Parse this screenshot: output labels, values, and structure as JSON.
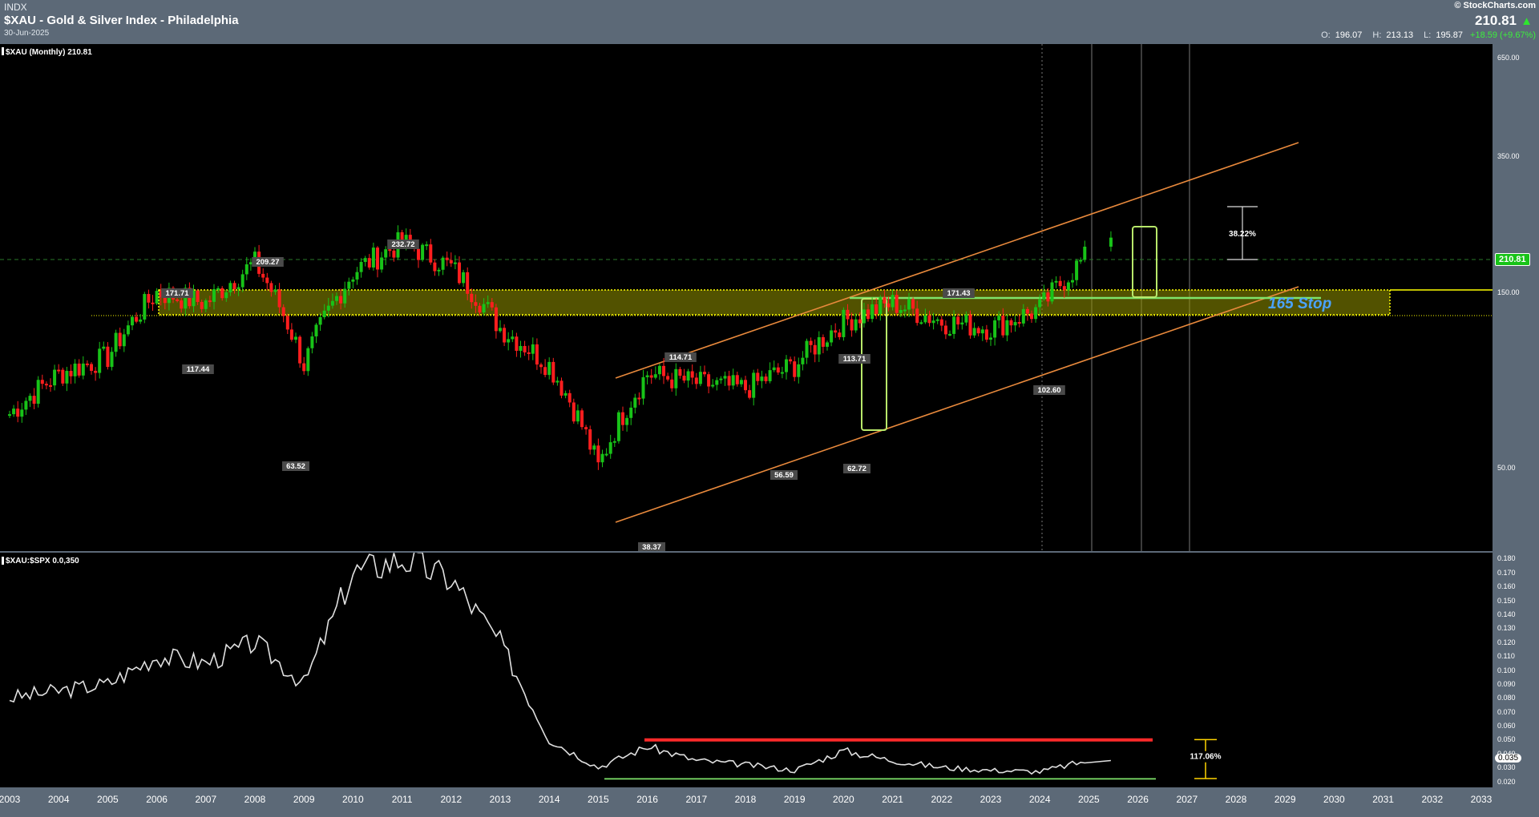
{
  "header": {
    "exchange": "INDX",
    "title": "$XAU - Gold & Silver Index - Philadelphia",
    "date": "30-Jun-2025",
    "brand": "© StockCharts.com",
    "price": "210.81",
    "open_label": "O:",
    "open": "196.07",
    "high_label": "H:",
    "high": "213.13",
    "low_label": "L:",
    "low": "195.87",
    "change": "+18.59 (+9.67%)"
  },
  "colors": {
    "up": "#18c318",
    "down": "#ff1e1e",
    "channel": "#e8893c",
    "zone": "#ffff00",
    "support": "#7ee36a",
    "ratio": "#e0e0e0",
    "annot": "#4aa3ff"
  },
  "main": {
    "legend": "$XAU (Monthly) 210.81",
    "last_price_tag": "210.81",
    "stop_label": "165 Stop",
    "measure_label": "38.22%",
    "labels": [
      "232.72",
      "209.27",
      "171.71",
      "117.44",
      "63.52",
      "114.71",
      "56.59",
      "113.71",
      "62.72",
      "171.43",
      "102.60",
      "38.37"
    ]
  },
  "ratio": {
    "legend": "$XAU:$SPX 0.0,350",
    "last_tag": "0.035",
    "measure_label": "117.06%"
  },
  "chart_data": [
    {
      "type": "line",
      "title": "$XAU (Monthly) 210.81",
      "x": [
        "2003",
        "2004",
        "2005",
        "2006",
        "2007",
        "2008",
        "2009",
        "2010",
        "2011",
        "2012",
        "2013",
        "2014",
        "2015",
        "2016",
        "2017",
        "2018",
        "2019",
        "2020",
        "2021",
        "2022",
        "2023",
        "2024",
        "2025"
      ],
      "values": [
        70,
        90,
        100,
        150,
        140,
        180,
        95,
        170,
        205,
        175,
        120,
        95,
        50,
        90,
        85,
        82,
        95,
        125,
        140,
        125,
        120,
        135,
        190
      ],
      "y_ticks": [
        "650.00",
        "350.00",
        "150.00",
        "50.00"
      ],
      "ylim": [
        30,
        700
      ],
      "scale": "log",
      "annotations": [
        "232.72",
        "209.27",
        "171.71",
        "117.44",
        "63.52",
        "114.71",
        "56.59",
        "113.71",
        "62.72",
        "171.43",
        "102.60",
        "38.37",
        "165 Stop",
        "38.22%"
      ]
    },
    {
      "type": "line",
      "title": "$XAU:$SPX 0.0,350",
      "x": [
        "2003",
        "2004",
        "2005",
        "2006",
        "2007",
        "2008",
        "2009",
        "2010",
        "2011",
        "2012",
        "2013",
        "2014",
        "2015",
        "2016",
        "2017",
        "2018",
        "2019",
        "2020",
        "2021",
        "2022",
        "2023",
        "2024",
        "2025"
      ],
      "values": [
        0.08,
        0.085,
        0.09,
        0.11,
        0.105,
        0.12,
        0.09,
        0.17,
        0.18,
        0.165,
        0.12,
        0.05,
        0.03,
        0.045,
        0.035,
        0.032,
        0.028,
        0.042,
        0.035,
        0.03,
        0.028,
        0.027,
        0.035
      ],
      "y_ticks": [
        "0.180",
        "0.170",
        "0.160",
        "0.150",
        "0.140",
        "0.130",
        "0.120",
        "0.110",
        "0.100",
        "0.090",
        "0.080",
        "0.070",
        "0.060",
        "0.050",
        "0.040",
        "0.030",
        "0.020"
      ],
      "ylim": [
        0.018,
        0.182
      ],
      "annotations": [
        "117.06%",
        "0.035"
      ]
    }
  ],
  "x_axis": [
    "2003",
    "2004",
    "2005",
    "2006",
    "2007",
    "2008",
    "2009",
    "2010",
    "2011",
    "2012",
    "2013",
    "2014",
    "2015",
    "2016",
    "2017",
    "2018",
    "2019",
    "2020",
    "2021",
    "2022",
    "2023",
    "2024",
    "2025",
    "2026",
    "2027",
    "2028",
    "2029",
    "2030",
    "2031",
    "2032",
    "2033"
  ]
}
